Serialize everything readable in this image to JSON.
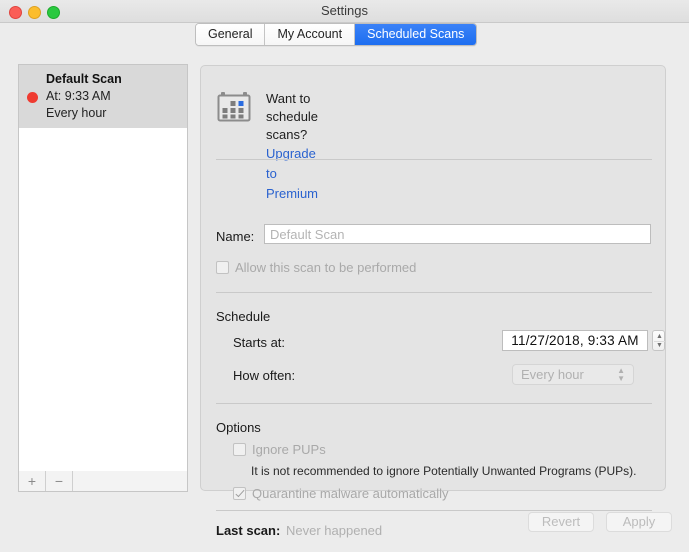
{
  "window": {
    "title": "Settings",
    "traffic_lights": [
      "close",
      "minimize",
      "maximize"
    ]
  },
  "tabs": [
    {
      "label": "General",
      "selected": false
    },
    {
      "label": "My Account",
      "selected": false
    },
    {
      "label": "Scheduled Scans",
      "selected": true
    }
  ],
  "sidebar": {
    "items": [
      {
        "name": "Default Scan",
        "time": "At: 9:33 AM",
        "frequency": "Every hour",
        "status_color": "#ef3b31",
        "selected": true
      }
    ],
    "toolbar": {
      "add_label": "+",
      "remove_label": "−"
    }
  },
  "panel": {
    "promo": {
      "question": "Want to schedule scans?",
      "link": "Upgrade to Premium",
      "icon": "calendar-icon",
      "link_color": "#2a62cf"
    },
    "name": {
      "label": "Name:",
      "value": "",
      "placeholder": "Default Scan"
    },
    "allow": {
      "label": "Allow this scan to be performed",
      "checked": false,
      "enabled": false
    },
    "schedule": {
      "heading": "Schedule",
      "starts_at_label": "Starts at:",
      "starts_at_value": "11/27/2018,  9:33 AM",
      "how_often_label": "How often:",
      "how_often_value": "Every hour",
      "how_often_options": [
        "Every hour"
      ],
      "enabled": false
    },
    "options": {
      "heading": "Options",
      "ignore_pups": {
        "label": "Ignore PUPs",
        "checked": false,
        "enabled": false
      },
      "pups_note": "It is not recommended to ignore Potentially Unwanted Programs (PUPs).",
      "quarantine": {
        "label": "Quarantine malware automatically",
        "checked": true,
        "enabled": false
      }
    },
    "last_scan": {
      "label": "Last scan:",
      "value": "Never happened"
    }
  },
  "footer": {
    "revert_label": "Revert",
    "apply_label": "Apply",
    "enabled": false
  }
}
